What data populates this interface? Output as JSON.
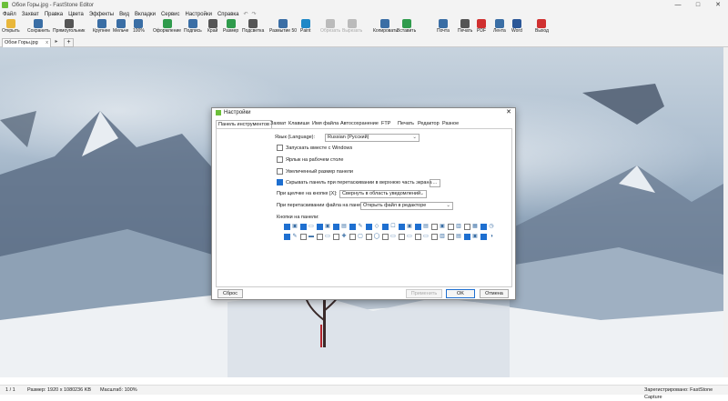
{
  "window": {
    "title": "Обои Горы.jpg - FastStone Editor",
    "controls": [
      "—",
      "□",
      "✕"
    ]
  },
  "menu": [
    "Файл",
    "Захват",
    "Правка",
    "Цвета",
    "Эффекты",
    "Вид",
    "Вкладки",
    "Сервис",
    "Настройки",
    "Справка"
  ],
  "undo": [
    "↶",
    "↷"
  ],
  "toolbar": [
    {
      "label": "Открыть",
      "icon": "open-folder-icon",
      "color": "#e9b73b"
    },
    {
      "label": "Сохранить",
      "icon": "save-icon",
      "color": "#3a6ea5"
    },
    {
      "label": "Прямоугольник",
      "icon": "rectangle-select-icon",
      "color": "#555555"
    },
    {
      "label": "Крупнее",
      "icon": "zoom-in-icon",
      "color": "#3a6ea5"
    },
    {
      "label": "Мельче",
      "icon": "zoom-out-icon",
      "color": "#3a6ea5"
    },
    {
      "label": "100%",
      "icon": "zoom-100-icon",
      "color": "#3a6ea5"
    },
    {
      "label": "Оформление",
      "icon": "draw-icon",
      "color": "#2f9b4c"
    },
    {
      "label": "Подпись",
      "icon": "caption-icon",
      "color": "#3a6ea5"
    },
    {
      "label": "Край",
      "icon": "edge-icon",
      "color": "#555555"
    },
    {
      "label": "Размер",
      "icon": "resize-icon",
      "color": "#2f9b4c"
    },
    {
      "label": "Подсветка",
      "icon": "spotlight-icon",
      "color": "#555555"
    },
    {
      "label": "Размытие 50",
      "icon": "blur-icon",
      "color": "#3a6ea5"
    },
    {
      "label": "Paint",
      "icon": "paint-icon",
      "color": "#1e88c7"
    },
    {
      "label": "Обрезать",
      "icon": "crop-icon",
      "color": "#bbbbbb"
    },
    {
      "label": "Вырезать",
      "icon": "cut-icon",
      "color": "#bbbbbb"
    },
    {
      "label": "Копировать",
      "icon": "copy-icon",
      "color": "#3a6ea5"
    },
    {
      "label": "Вставить",
      "icon": "paste-icon",
      "color": "#2f9b4c"
    },
    {
      "label": "Почта",
      "icon": "mail-icon",
      "color": "#3a6ea5"
    },
    {
      "label": "Печать",
      "icon": "print-icon",
      "color": "#555555"
    },
    {
      "label": "PDF",
      "icon": "pdf-icon",
      "color": "#d03030"
    },
    {
      "label": "Лента",
      "icon": "ribbon-icon",
      "color": "#3a6ea5"
    },
    {
      "label": "Word",
      "icon": "word-icon",
      "color": "#2b5797"
    },
    {
      "label": "Выход",
      "icon": "exit-icon",
      "color": "#d03030"
    }
  ],
  "file_tab": {
    "label": "Обои Горы.jpg",
    "close": "x",
    "arrow": "▸",
    "add": "+"
  },
  "dialog": {
    "title": "Настройки",
    "close": "✕",
    "tabs": [
      "Панель инструментов",
      "Захват",
      "Клавиши",
      "Имя файла",
      "Автосохранение",
      "FTP",
      "Печать",
      "Редактор",
      "Разное"
    ],
    "language_label": "Язык (Language):",
    "language_value": "Russian (Русский)",
    "checkboxes": [
      {
        "label": "Запускать вместе с Windows",
        "checked": false
      },
      {
        "label": "Ярлык на рабочем столе",
        "checked": false
      },
      {
        "label": "Увеличенный размер панели",
        "checked": false
      },
      {
        "label": "Скрывать панель при перетаскивании в верхнюю часть экрана",
        "checked": true
      }
    ],
    "dots": "...",
    "close_action_label": "При щелчке на кнопке [X]:",
    "close_action_value": "Свернуть в область уведомлений",
    "drop_action_label": "При перетаскивании файла на панель:",
    "drop_action_value": "Открыть файл в редакторе",
    "buttons_label": "Кнопки на панели:",
    "panel_buttons_row1": [
      true,
      true,
      true,
      true,
      true,
      true,
      true,
      true,
      true,
      false,
      false,
      false,
      true
    ],
    "panel_buttons_row2": [
      true,
      false,
      false,
      false,
      false,
      false,
      false,
      false,
      false,
      false,
      false,
      true,
      true
    ],
    "reset": "Сброс",
    "apply": "Применить",
    "ok": "OK",
    "cancel": "Отмена"
  },
  "status": {
    "page": "1 / 1",
    "size": "Размер: 1920 x 1080",
    "filesize": "236 KB",
    "zoom": "Масштаб: 100%",
    "registered": "Зарегистрировано: FastStone Capture"
  }
}
